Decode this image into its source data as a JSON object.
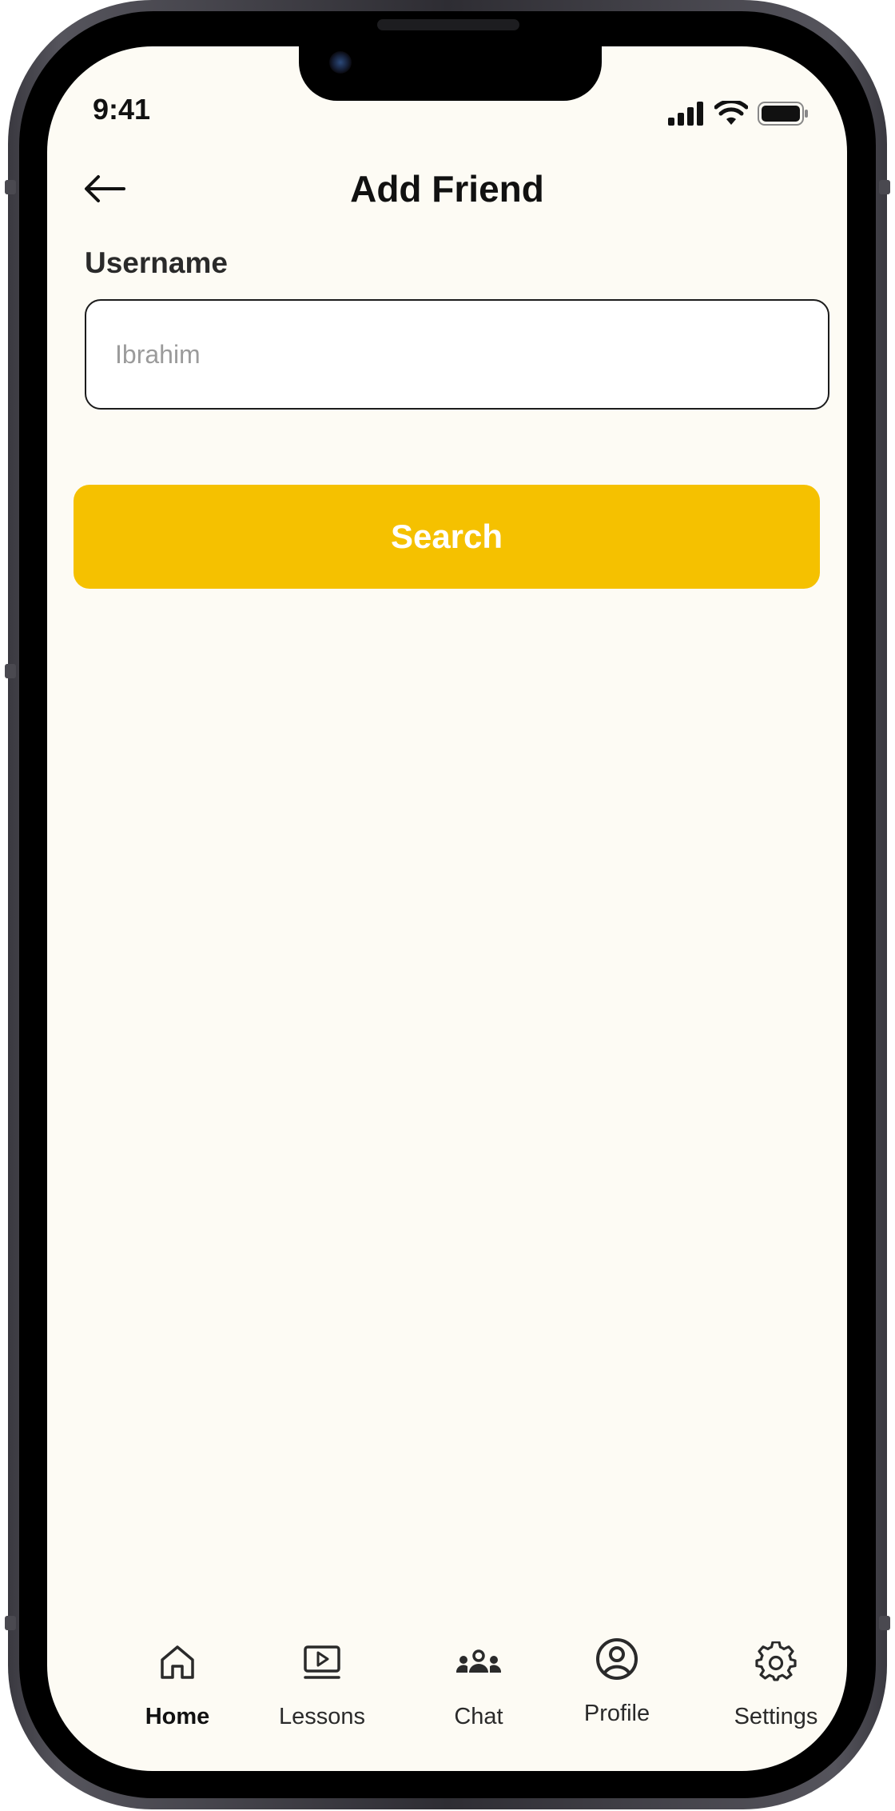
{
  "status_bar": {
    "time": "9:41"
  },
  "header": {
    "back_icon": "arrow-left-icon",
    "title": "Add Friend"
  },
  "form": {
    "username_label": "Username",
    "username_placeholder": "Ibrahim",
    "username_value": ""
  },
  "actions": {
    "search_label": "Search",
    "search_color": "#f5c100"
  },
  "tabbar": {
    "items": [
      {
        "label": "Home",
        "icon": "home-icon",
        "active": true
      },
      {
        "label": "Lessons",
        "icon": "video-lesson-icon",
        "active": false
      },
      {
        "label": "Chat",
        "icon": "group-chat-icon",
        "active": false
      },
      {
        "label": "Profile",
        "icon": "user-circle-icon",
        "active": false
      },
      {
        "label": "Settings",
        "icon": "gear-icon",
        "active": false
      }
    ]
  },
  "colors": {
    "background": "#fdfbf4",
    "text": "#111111",
    "accent": "#f5c100"
  }
}
